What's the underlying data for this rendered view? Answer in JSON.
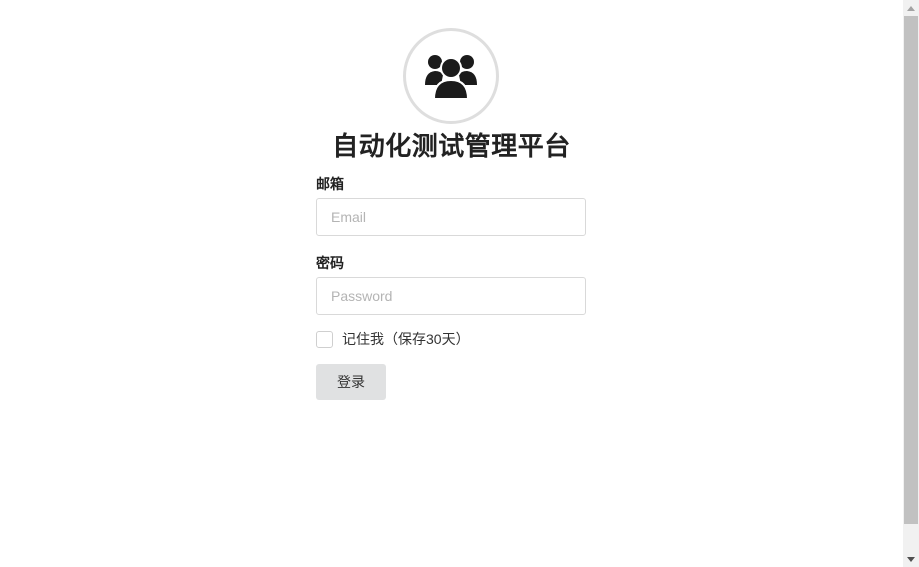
{
  "app": {
    "title": "自动化测试管理平台",
    "logo_icon": "users-group-icon"
  },
  "form": {
    "email": {
      "label": "邮箱",
      "placeholder": "Email",
      "value": ""
    },
    "password": {
      "label": "密码",
      "placeholder": "Password",
      "value": ""
    },
    "remember": {
      "label": "记住我（保存30天）",
      "checked": false
    },
    "submit_label": "登录"
  },
  "colors": {
    "title": "#222222",
    "input_border": "#d9d9d9",
    "button_bg": "#e0e1e2",
    "logo_ring": "#dedede",
    "icon": "#1b1b1b"
  }
}
